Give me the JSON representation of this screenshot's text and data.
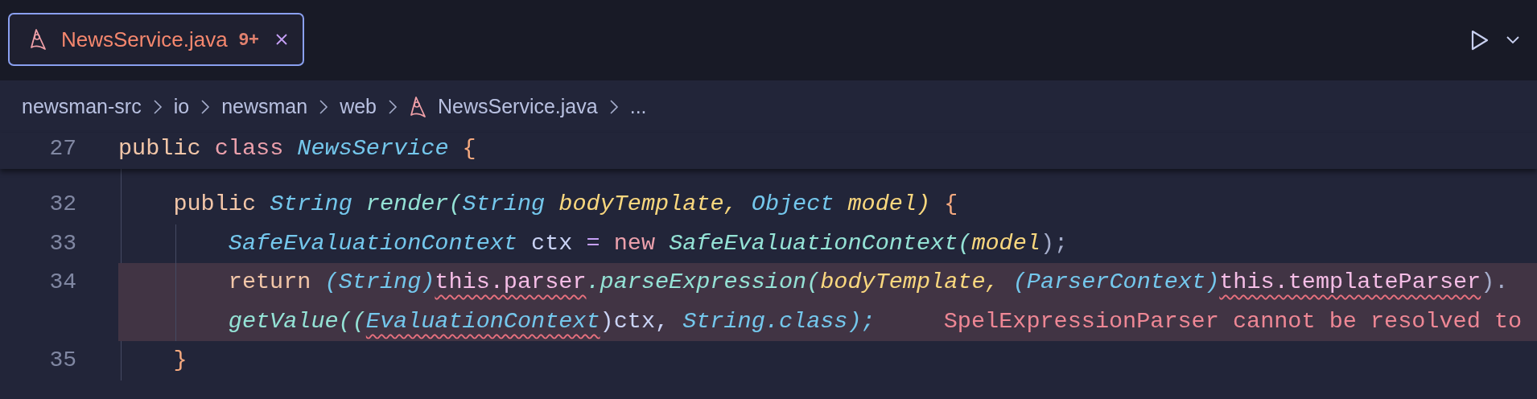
{
  "tabs": [
    {
      "label": "NewsService.java",
      "badge": "9+",
      "selected": true
    }
  ],
  "breadcrumbs": [
    {
      "kind": "folder",
      "label": "newsman-src"
    },
    {
      "kind": "folder",
      "label": "io"
    },
    {
      "kind": "folder",
      "label": "newsman"
    },
    {
      "kind": "folder",
      "label": "web"
    },
    {
      "kind": "file",
      "label": "NewsService.java"
    },
    {
      "kind": "more",
      "label": "..."
    }
  ],
  "editor": {
    "sticky_line": {
      "number": "27",
      "highlighted": false,
      "rows": [
        {
          "tokens": [
            {
              "text": "public ",
              "kind": "keyword",
              "squiggle": false
            },
            {
              "text": "class ",
              "kind": "keyword2",
              "squiggle": false
            },
            {
              "text": "NewsService ",
              "kind": "type",
              "squiggle": false
            },
            {
              "text": "{",
              "kind": "brace",
              "squiggle": false
            }
          ]
        }
      ]
    },
    "lines": [
      {
        "number": "32",
        "highlighted": false,
        "rows": [
          {
            "tokens": [
              {
                "text": "public ",
                "kind": "keyword",
                "squiggle": false
              },
              {
                "text": "String ",
                "kind": "type",
                "squiggle": false
              },
              {
                "text": "render(",
                "kind": "method",
                "squiggle": false
              },
              {
                "text": "String ",
                "kind": "type",
                "squiggle": false
              },
              {
                "text": "bodyTemplate, ",
                "kind": "param",
                "squiggle": false
              },
              {
                "text": "Object ",
                "kind": "type",
                "squiggle": false
              },
              {
                "text": "model) ",
                "kind": "param",
                "squiggle": false
              },
              {
                "text": "{",
                "kind": "brace",
                "squiggle": false
              }
            ]
          }
        ],
        "children": [
          {
            "number": "33",
            "highlighted": false,
            "rows": [
              {
                "tokens": [
                  {
                    "text": "SafeEvaluationContext ",
                    "kind": "type",
                    "squiggle": false
                  },
                  {
                    "text": "ctx ",
                    "kind": "plain",
                    "squiggle": false
                  },
                  {
                    "text": "= ",
                    "kind": "operator",
                    "squiggle": false
                  },
                  {
                    "text": "new ",
                    "kind": "keyword2",
                    "squiggle": false
                  },
                  {
                    "text": "SafeEvaluationContext(",
                    "kind": "method",
                    "squiggle": false
                  },
                  {
                    "text": "model",
                    "kind": "param",
                    "squiggle": false
                  },
                  {
                    "text": ");",
                    "kind": "punct",
                    "squiggle": false
                  }
                ]
              }
            ]
          },
          {
            "number": "34",
            "highlighted": true,
            "diagnostic": "SpelExpressionParser cannot be resolved to",
            "rows": [
              {
                "tokens": [
                  {
                    "text": "return ",
                    "kind": "keyword",
                    "squiggle": false
                  },
                  {
                    "text": "(String)",
                    "kind": "type",
                    "squiggle": false
                  },
                  {
                    "text": "this.parser",
                    "kind": "field",
                    "squiggle": true
                  },
                  {
                    "text": ".parseExpression(",
                    "kind": "method",
                    "squiggle": false
                  },
                  {
                    "text": "bodyTemplate, ",
                    "kind": "param",
                    "squiggle": false
                  },
                  {
                    "text": "(ParserContext)",
                    "kind": "type",
                    "squiggle": false
                  },
                  {
                    "text": "this.templateParser",
                    "kind": "field",
                    "squiggle": true
                  },
                  {
                    "text": ").",
                    "kind": "punct",
                    "squiggle": false
                  }
                ]
              },
              {
                "tokens": [
                  {
                    "text": "getValue((",
                    "kind": "method",
                    "squiggle": false
                  },
                  {
                    "text": "EvaluationContext",
                    "kind": "type",
                    "squiggle": true
                  },
                  {
                    "text": ")ctx, ",
                    "kind": "plain",
                    "squiggle": false
                  },
                  {
                    "text": "String.class);",
                    "kind": "type",
                    "squiggle": false
                  }
                ]
              }
            ]
          }
        ]
      },
      {
        "number": "35",
        "highlighted": false,
        "rows": [
          {
            "tokens": [
              {
                "text": "}",
                "kind": "brace",
                "squiggle": false
              }
            ]
          }
        ]
      }
    ]
  }
}
